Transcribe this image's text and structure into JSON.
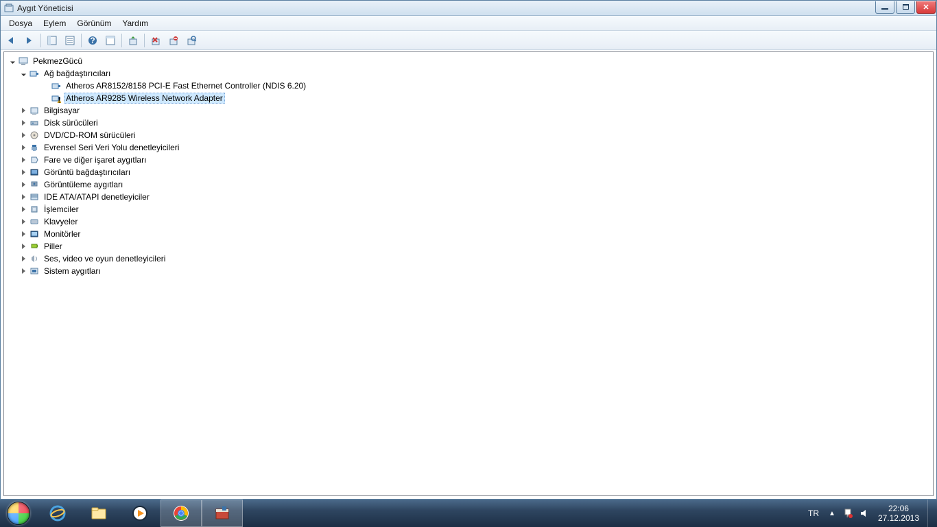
{
  "window": {
    "title": "Aygıt Yöneticisi"
  },
  "menu": {
    "file": "Dosya",
    "action": "Eylem",
    "view": "Görünüm",
    "help": "Yardım"
  },
  "tree": {
    "root": "PekmezGücü",
    "network": {
      "label": "Ağ bağdaştırıcıları",
      "items": [
        "Atheros AR8152/8158 PCI-E Fast Ethernet Controller (NDIS 6.20)",
        "Atheros AR9285 Wireless Network Adapter"
      ]
    },
    "categories": [
      "Bilgisayar",
      "Disk sürücüleri",
      "DVD/CD-ROM sürücüleri",
      "Evrensel Seri Veri Yolu denetleyicileri",
      "Fare ve diğer işaret aygıtları",
      "Görüntü bağdaştırıcıları",
      "Görüntüleme aygıtları",
      "IDE ATA/ATAPI denetleyiciler",
      "İşlemciler",
      "Klavyeler",
      "Monitörler",
      "Piller",
      "Ses, video ve oyun denetleyicileri",
      "Sistem aygıtları"
    ]
  },
  "taskbar": {
    "lang": "TR",
    "time": "22:06",
    "date": "27.12.2013"
  }
}
